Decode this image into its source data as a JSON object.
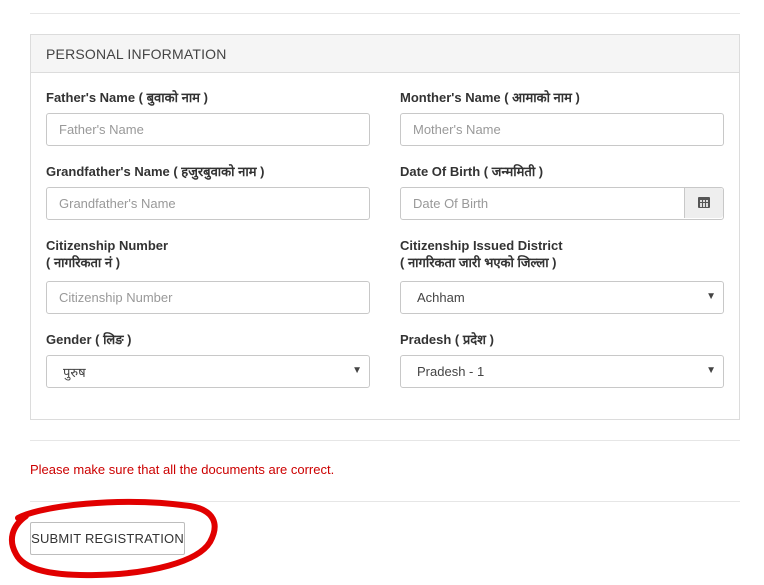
{
  "section": {
    "title": "PERSONAL INFORMATION"
  },
  "fields": {
    "father_name": {
      "label": "Father's Name ( बुवाको नाम )",
      "placeholder": "Father's Name"
    },
    "mother_name": {
      "label": "Monther's Name ( आमाको नाम )",
      "placeholder": "Mother's Name"
    },
    "grandfather_name": {
      "label": "Grandfather's Name ( हजुरबुवाको नाम )",
      "placeholder": "Grandfather's Name"
    },
    "dob": {
      "label": "Date Of Birth ( जन्ममिती )",
      "placeholder": "Date Of Birth",
      "icon": "calendar-icon"
    },
    "citizenship_number": {
      "label_line1": "Citizenship Number",
      "label_line2": "( नागरिकता नं )",
      "placeholder": "Citizenship Number"
    },
    "citizenship_district": {
      "label_line1": "Citizenship Issued District",
      "label_line2": "( नागरिकता जारी भएको जिल्ला )",
      "value": "Achham"
    },
    "gender": {
      "label": "Gender ( लिङ )",
      "value": "पुरुष"
    },
    "pradesh": {
      "label": "Pradesh ( प्रदेश )",
      "value": "Pradesh - 1"
    }
  },
  "notice": {
    "text": "Please make sure that all the documents are correct.",
    "color": "#cc0000"
  },
  "submit": {
    "label": "SUBMIT REGISTRATION"
  },
  "annotation": {
    "color": "#e10000",
    "shape": "hand-drawn-circle"
  }
}
